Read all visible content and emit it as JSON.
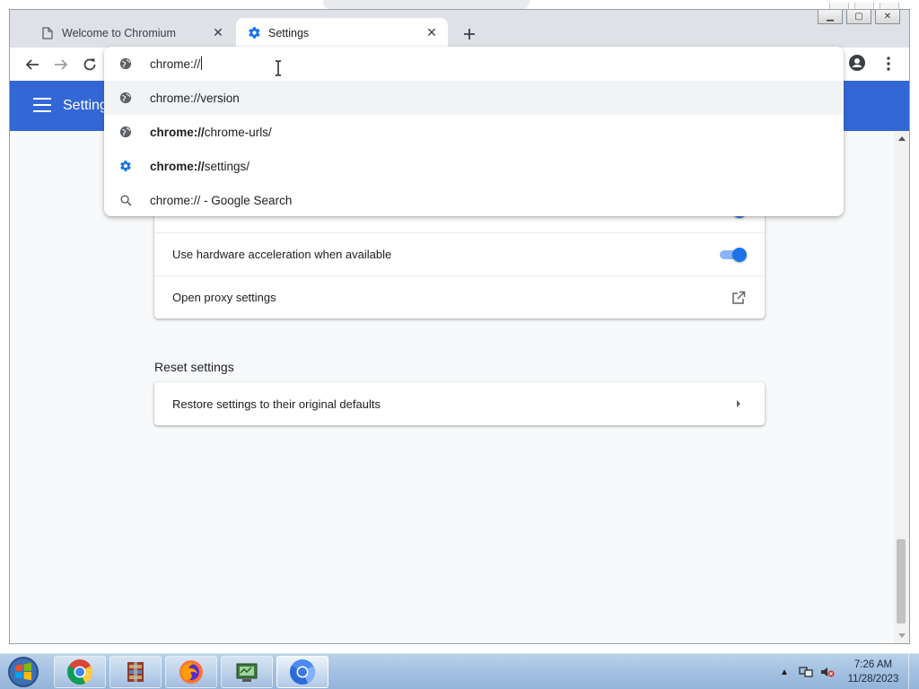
{
  "tabs": [
    {
      "label": "Welcome to Chromium",
      "icon": "page-icon",
      "active": false
    },
    {
      "label": "Settings",
      "icon": "gear-icon",
      "active": true
    }
  ],
  "omnibox": {
    "input_value": "chrome://",
    "suggestions": [
      {
        "icon": "globe-icon",
        "bold": "",
        "text": "chrome://version",
        "selected": true
      },
      {
        "icon": "globe-icon",
        "bold": "chrome://",
        "text": "chrome-urls/",
        "selected": false
      },
      {
        "icon": "gear-icon",
        "bold": "chrome://",
        "text": "settings/",
        "selected": false
      },
      {
        "icon": "search-icon",
        "bold": "",
        "text": "chrome:// - Google Search",
        "selected": false
      }
    ]
  },
  "settings": {
    "header_title": "Settings",
    "system_rows": [
      {
        "label": "Use hardware acceleration when available",
        "control": "toggle",
        "on": true
      },
      {
        "label": "Open proxy settings",
        "control": "external-link-icon"
      }
    ],
    "reset_section_title": "Reset settings",
    "reset_row_label": "Restore settings to their original defaults"
  },
  "taskbar": {
    "apps": [
      "chrome-icon",
      "archive-icon",
      "firefox-icon",
      "network-app-icon",
      "chromium-icon"
    ],
    "clock_time": "7:26 AM",
    "clock_date": "11/28/2023"
  },
  "colors": {
    "accent": "#1a73e8",
    "header_blue": "#3367d6"
  }
}
